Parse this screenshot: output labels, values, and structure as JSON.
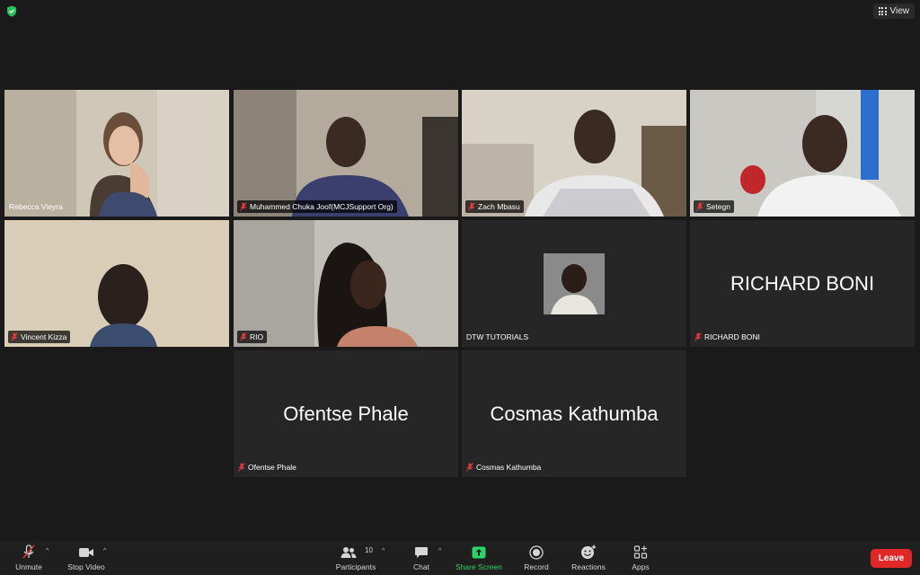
{
  "colors": {
    "background": "#1a1a1a",
    "active_speaker": "#23d959",
    "leave": "#e02828",
    "share": "#2ed36b"
  },
  "header": {
    "view_label": "View",
    "security_icon": "shield-check-icon"
  },
  "tiles": [
    {
      "name": "Rebecca Vieyra",
      "video": true,
      "muted": false,
      "active": true
    },
    {
      "name": "Muhammed Chuka Joof(MCJSupport Org)",
      "video": true,
      "muted": true
    },
    {
      "name": "Zach Mbasu",
      "video": true,
      "muted": true
    },
    {
      "name": "Setegn",
      "video": true,
      "muted": true
    },
    {
      "name": "Vincent Kizza",
      "video": true,
      "muted": true
    },
    {
      "name": "RIO",
      "video": true,
      "muted": true
    },
    {
      "name": "DTW TUTORIALS",
      "video": false,
      "muted": false,
      "profile_picture": true
    },
    {
      "name": "RICHARD BONI",
      "video": false,
      "muted": true,
      "display_name": "RICHARD BONI"
    },
    {
      "name": "Ofentse Phale",
      "video": false,
      "muted": true,
      "display_name": "Ofentse Phale"
    },
    {
      "name": "Cosmas Kathumba",
      "video": false,
      "muted": true,
      "display_name": "Cosmas Kathumba"
    }
  ],
  "toolbar": {
    "unmute": "Unmute",
    "stop_video": "Stop Video",
    "participants": "Participants",
    "participants_count": "10",
    "chat": "Chat",
    "share_screen": "Share Screen",
    "record": "Record",
    "reactions": "Reactions",
    "apps": "Apps",
    "leave": "Leave"
  }
}
